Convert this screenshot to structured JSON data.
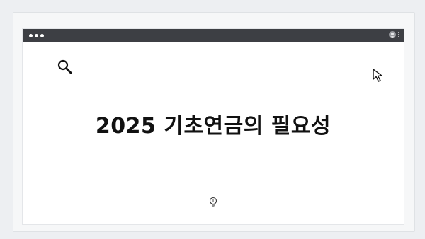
{
  "carousel": {
    "dot_count": 4
  },
  "window": {
    "titlebar_color": "#3d3f44",
    "icons": [
      "search-icon",
      "cursor-icon",
      "lightbulb-icon",
      "user-icon",
      "more-vertical-icon"
    ]
  },
  "main": {
    "headline": "2025 기초연금의 필요성"
  }
}
